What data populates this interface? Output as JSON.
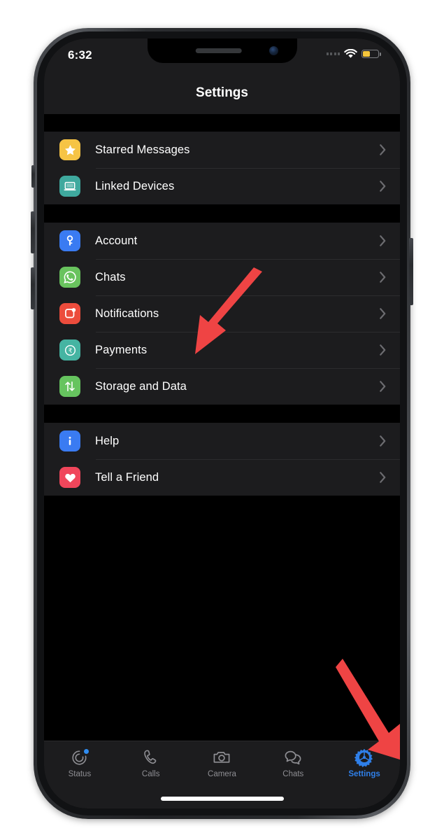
{
  "device": {
    "frame": "iphone-12",
    "buttons": [
      "mute-switch",
      "volume-up",
      "volume-down",
      "power"
    ]
  },
  "status_bar": {
    "time": "6:32",
    "wifi_icon": "wifi-icon",
    "battery_icon": "battery-low-power-icon",
    "battery_color": "#f5c63c",
    "signal_icon": "signal-dots-icon"
  },
  "nav_bar": {
    "title": "Settings"
  },
  "groups": [
    {
      "name": "group-messages",
      "rows": [
        {
          "label": "Starred Messages",
          "icon": "star-icon",
          "icon_bg": "#f6c445"
        },
        {
          "label": "Linked Devices",
          "icon": "laptop-icon",
          "icon_bg": "#3fa99e"
        }
      ]
    },
    {
      "name": "group-account",
      "rows": [
        {
          "label": "Account",
          "icon": "key-icon",
          "icon_bg": "#3a7bf2"
        },
        {
          "label": "Chats",
          "icon": "whatsapp-icon",
          "icon_bg": "#69c35e"
        },
        {
          "label": "Notifications",
          "icon": "notification-icon",
          "icon_bg": "#ec4c3c"
        },
        {
          "label": "Payments",
          "icon": "rupee-icon",
          "icon_bg": "#45b4a2"
        },
        {
          "label": "Storage and Data",
          "icon": "transfer-icon",
          "icon_bg": "#66c45f"
        }
      ]
    },
    {
      "name": "group-support",
      "rows": [
        {
          "label": "Help",
          "icon": "info-icon",
          "icon_bg": "#3a7bf2"
        },
        {
          "label": "Tell a Friend",
          "icon": "heart-icon",
          "icon_bg": "#f0465b"
        }
      ]
    }
  ],
  "chevron_icon": "chevron-right-icon",
  "tab_bar": {
    "active": "Settings",
    "active_color": "#2f7fe8",
    "inactive_color": "#8e8e93",
    "items": [
      {
        "label": "Status",
        "icon": "status-ring-icon",
        "badge": true
      },
      {
        "label": "Calls",
        "icon": "phone-icon",
        "badge": false
      },
      {
        "label": "Camera",
        "icon": "camera-icon",
        "badge": false
      },
      {
        "label": "Chats",
        "icon": "chat-bubbles-icon",
        "badge": false
      },
      {
        "label": "Settings",
        "icon": "gear-icon",
        "badge": false
      }
    ]
  },
  "annotations": {
    "color": "#ef4444",
    "arrows": [
      {
        "name": "arrow-pointing-to-chats",
        "target": "Chats"
      },
      {
        "name": "arrow-pointing-to-settings-tab",
        "target": "Settings"
      }
    ]
  }
}
